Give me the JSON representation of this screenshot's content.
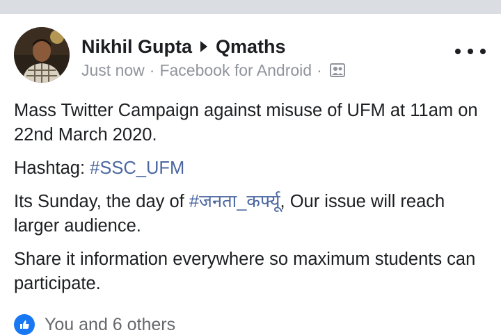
{
  "post": {
    "author_name": "Nikhil Gupta",
    "group_name": "Qmaths",
    "timestamp": "Just now",
    "separator": "·",
    "source": "Facebook for Android",
    "audience_icon": "group-audience-icon",
    "body": {
      "p1": "Mass Twitter Campaign against misuse of UFM at 11am on 22nd March 2020.",
      "p2_prefix": "Hashtag: ",
      "p2_hashtag": "#SSC_UFM",
      "p3_prefix": "Its Sunday, the day of ",
      "p3_hashtag": "#जनता_कर्फ्यू",
      "p3_suffix": ", Our issue will reach larger audience.",
      "p4": "Share it information everywhere so maximum students can participate."
    },
    "reactions_text": "You and 6 others"
  },
  "colors": {
    "text_primary": "#1c1e21",
    "text_meta": "#90949c",
    "hashtag": "#4b67a1",
    "top_band": "#dadde1",
    "like_blue": "#1877f2"
  }
}
